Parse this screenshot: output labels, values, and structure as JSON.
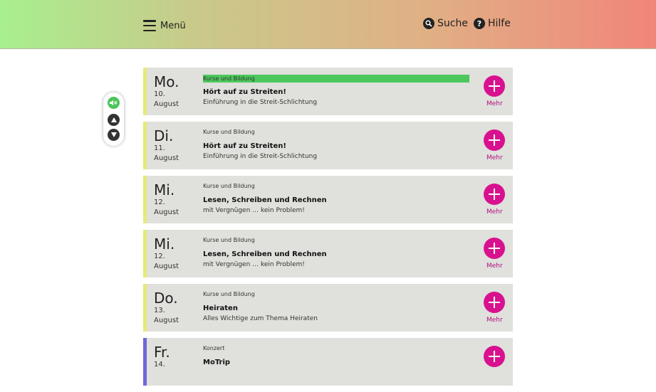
{
  "header": {
    "menu_label": "Menü",
    "search_label": "Suche",
    "help_label": "Hilfe",
    "help_icon_glyph": "?"
  },
  "colors": {
    "header_gradient": [
      "#a8ef8f",
      "#c9c98a",
      "#e0b085",
      "#f1857a"
    ],
    "card_bg": "#e0e0dc",
    "accent_kurse": "#e6ea78",
    "accent_konzert": "#6f67d8",
    "plus_button": "#d8118f",
    "highlight": "#4cc85c"
  },
  "a11y_widget": {
    "buttons": [
      "speaker-mute-icon",
      "arrow-up-icon",
      "arrow-down-icon"
    ]
  },
  "events": [
    {
      "dow": "Mo.",
      "day": "10.",
      "month": "August",
      "category": "Kurse und Bildung",
      "title": "Hört auf zu Streiten!",
      "subtitle": "Einführung in die Streit-Schlichtung",
      "more": "Mehr",
      "highlighted": true
    },
    {
      "dow": "Di.",
      "day": "11.",
      "month": "August",
      "category": "Kurse und Bildung",
      "title": "Hört auf zu Streiten!",
      "subtitle": "Einführung in die Streit-Schlichtung",
      "more": "Mehr"
    },
    {
      "dow": "Mi.",
      "day": "12.",
      "month": "August",
      "category": "Kurse und Bildung",
      "title": "Lesen, Schreiben und Rechnen",
      "subtitle": "mit Vergnügen … kein Problem!",
      "more": "Mehr"
    },
    {
      "dow": "Mi.",
      "day": "12.",
      "month": "August",
      "category": "Kurse und Bildung",
      "title": "Lesen, Schreiben und Rechnen",
      "subtitle": "mit Vergnügen … kein Problem!",
      "more": "Mehr"
    },
    {
      "dow": "Do.",
      "day": "13.",
      "month": "August",
      "category": "Kurse und Bildung",
      "title": "Heiraten",
      "subtitle": "Alles Wichtige zum Thema Heiraten",
      "more": "Mehr"
    },
    {
      "dow": "Fr.",
      "day": "14.",
      "month": "",
      "category": "Konzert",
      "title": "MoTrip",
      "subtitle": "",
      "more": ""
    }
  ]
}
